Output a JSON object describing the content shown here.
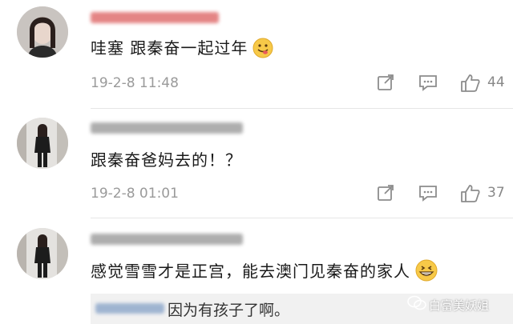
{
  "comments": [
    {
      "text": "哇塞 跟秦奋一起过年",
      "emoji": "yum-face-emoji",
      "time": "19-2-8 11:48",
      "likes": "44"
    },
    {
      "text": "跟秦奋爸妈去的！？",
      "time": "19-2-8 01:01",
      "likes": "37"
    },
    {
      "text": "感觉雪雪才是正宫，能去澳门见秦奋的家人",
      "emoji": "grinning-face-emoji",
      "reply": {
        "text": "因为有孩子了啊。"
      }
    }
  ],
  "watermark": {
    "text": "白富美妖姐"
  },
  "colors": {
    "text": "#1a1a1a",
    "meta": "#9a9a9a",
    "reply_bg": "#f1f1f1",
    "username_blur_1": "#e07070",
    "username_blur_2": "#a0a0a0"
  }
}
